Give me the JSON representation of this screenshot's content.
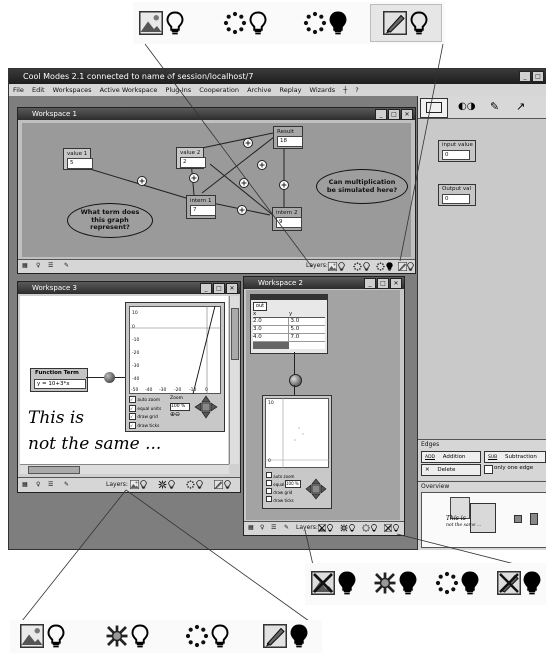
{
  "app": {
    "title": "Cool Modes 2.1 connected to name of session/localhost/7",
    "menu": [
      "File",
      "Edit",
      "Workspaces",
      "Active Workspace",
      "Plug-Ins",
      "Cooperation",
      "Archive",
      "Replay",
      "Wizards",
      "?"
    ]
  },
  "workspace1": {
    "title": "Workspace 1",
    "nodes": {
      "value1": {
        "label": "value 1",
        "value": "5"
      },
      "value2": {
        "label": "value 2",
        "value": "2"
      },
      "result": {
        "label": "Result",
        "value": "18"
      },
      "intern1": {
        "label": "intern 1",
        "value": "7"
      },
      "intern2": {
        "label": "intern 2",
        "value": "9"
      }
    },
    "question1": "What term does this graph represent?",
    "question2": "Can multiplication be simulated here?",
    "layers_label": "Layers:"
  },
  "workspace3": {
    "title": "Workspace 3",
    "function_term_label": "Function Term",
    "function_value": "y = 10+3*x",
    "plot_controls": [
      "auto zoom",
      "equal units",
      "draw grid",
      "draw ticks"
    ],
    "zoom_label": "Zoom",
    "zoom_value": "100 %",
    "y_ticks": [
      "10",
      "0",
      "-10",
      "-20",
      "-30",
      "-40",
      "-50"
    ],
    "x_ticks": [
      "-50",
      "-40",
      "-30",
      "-20",
      "-10",
      "0"
    ],
    "handwriting_line1": "This is",
    "handwriting_line2": "not the same ...",
    "layers_label": "Layers:"
  },
  "workspace2": {
    "title": "Workspace 2",
    "table_tab": "out",
    "table_headers": [
      "x",
      "y"
    ],
    "table_rows": [
      [
        "2.0",
        "3.0"
      ],
      [
        "3.0",
        "5.0"
      ],
      [
        "4.0",
        "7.0"
      ]
    ],
    "plot_controls": [
      "auto zoom",
      "equal units",
      "draw grid",
      "draw ticks"
    ],
    "zoom_value": "100 %",
    "y_ticks": [
      "10",
      "0"
    ],
    "layers_label": "Layers:"
  },
  "sidepanel": {
    "input_label": "input value",
    "input_value": "0",
    "output_label": "Output val",
    "output_value": "0",
    "edges_title": "Edges",
    "edge_buttons": [
      {
        "op": "ADD",
        "label": "Addition"
      },
      {
        "op": "SUB",
        "label": "Subtraction"
      },
      {
        "op": "",
        "label": "Delete"
      }
    ],
    "only_one_edge": "only one edge",
    "overview_title": "Overview",
    "overview_hw1": "This is",
    "overview_hw2": "not the same ..."
  },
  "colors": {
    "canvas": "#9a9a9a",
    "window": "#c0c0c0",
    "titlebar": "#2c2c2c"
  }
}
